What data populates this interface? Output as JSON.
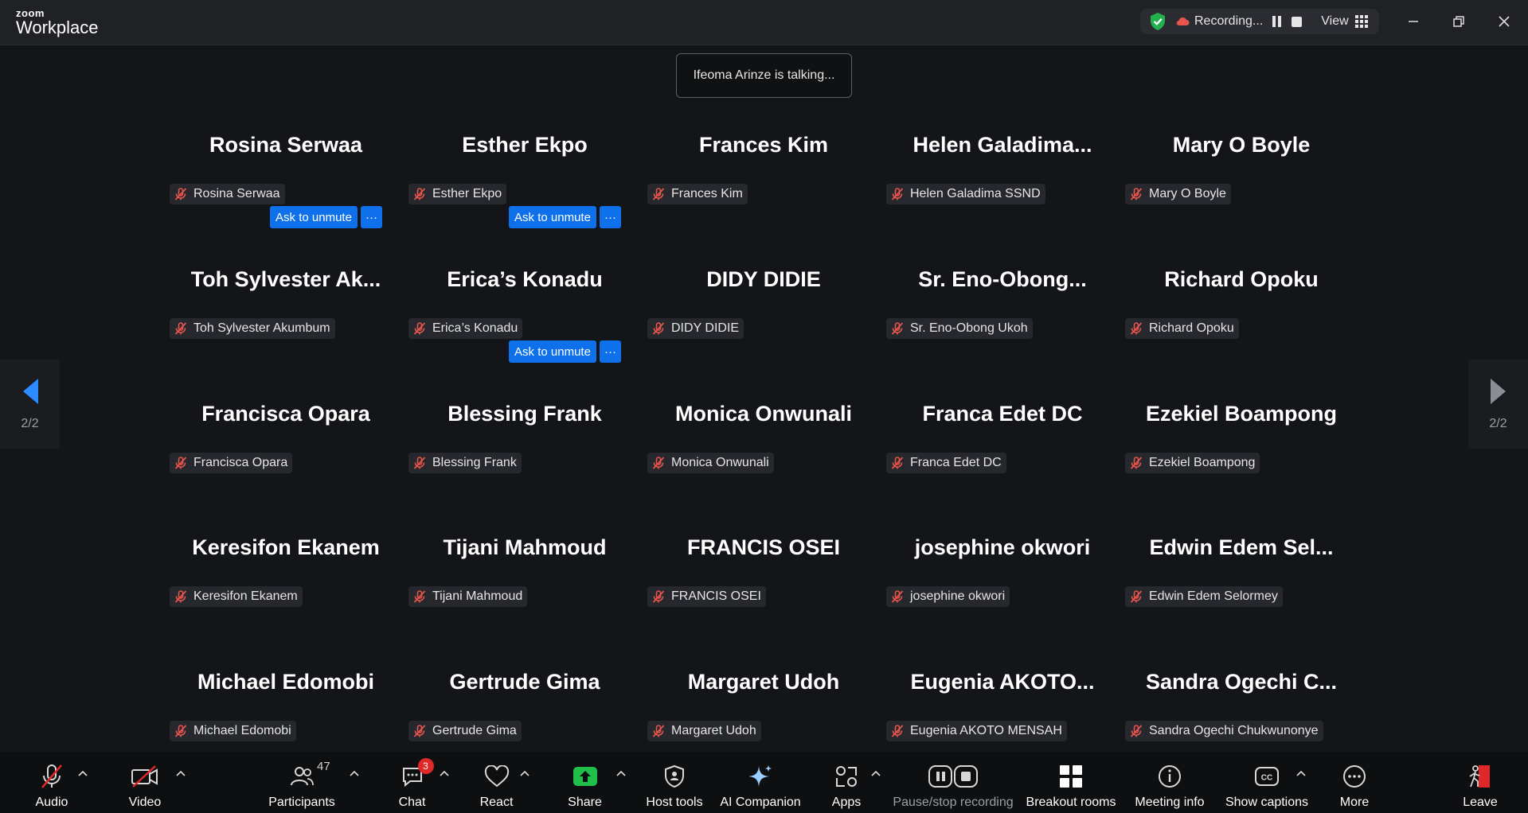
{
  "titlebar": {
    "brand_small": "zoom",
    "brand_big": "Workplace",
    "recording_label": "Recording...",
    "view_label": "View"
  },
  "toast": "Ifeoma Arinze is talking...",
  "ask_label": "Ask to unmute",
  "more_label": "···",
  "pager": {
    "left": "2/2",
    "right": "2/2"
  },
  "participants": [
    {
      "display": "Rosina Serwaa",
      "label": "Rosina Serwaa",
      "ask": true
    },
    {
      "display": "Esther Ekpo",
      "label": "Esther Ekpo",
      "ask": true
    },
    {
      "display": "Frances Kim",
      "label": "Frances Kim",
      "ask": false
    },
    {
      "display": "Helen  Galadima...",
      "label": "Helen Galadima SSND",
      "ask": false
    },
    {
      "display": "Mary O Boyle",
      "label": "Mary O Boyle",
      "ask": false
    },
    {
      "display": "Toh Sylvester Ak...",
      "label": "Toh Sylvester Akumbum",
      "ask": false
    },
    {
      "display": "Erica’s Konadu",
      "label": "Erica’s Konadu",
      "ask": true
    },
    {
      "display": "DIDY DIDIE",
      "label": "DIDY DIDIE",
      "ask": false
    },
    {
      "display": "Sr.  Eno-Obong...",
      "label": "Sr. Eno-Obong Ukoh",
      "ask": false
    },
    {
      "display": "Richard Opoku",
      "label": "Richard Opoku",
      "ask": false
    },
    {
      "display": "Francisca Opara",
      "label": "Francisca Opara",
      "ask": false
    },
    {
      "display": "Blessing Frank",
      "label": "Blessing Frank",
      "ask": false
    },
    {
      "display": "Monica Onwunali",
      "label": "Monica Onwunali",
      "ask": false
    },
    {
      "display": "Franca Edet DC",
      "label": "Franca Edet DC",
      "ask": false
    },
    {
      "display": "Ezekiel Boampong",
      "label": "Ezekiel Boampong",
      "ask": false
    },
    {
      "display": "Keresifon Ekanem",
      "label": "Keresifon Ekanem",
      "ask": false
    },
    {
      "display": "Tijani Mahmoud",
      "label": "Tijani Mahmoud",
      "ask": false
    },
    {
      "display": "FRANCIS OSEI",
      "label": "FRANCIS OSEI",
      "ask": false
    },
    {
      "display": "josephine okwori",
      "label": "josephine okwori",
      "ask": false
    },
    {
      "display": "Edwin Edem Sel...",
      "label": "Edwin Edem Selormey",
      "ask": false
    },
    {
      "display": "Michael Edomobi",
      "label": "Michael Edomobi",
      "ask": false
    },
    {
      "display": "Gertrude Gima",
      "label": "Gertrude Gima",
      "ask": false
    },
    {
      "display": "Margaret Udoh",
      "label": "Margaret Udoh",
      "ask": false
    },
    {
      "display": "Eugenia  AKOTO...",
      "label": "Eugenia AKOTO MENSAH",
      "ask": false
    },
    {
      "display": "Sandra Ogechi C...",
      "label": "Sandra Ogechi Chukwunonye",
      "ask": false
    }
  ],
  "toolbar": {
    "audio": "Audio",
    "video": "Video",
    "participants": "Participants",
    "participants_count": "47",
    "chat": "Chat",
    "chat_badge": "3",
    "react": "React",
    "share": "Share",
    "host_tools": "Host tools",
    "ai_companion": "AI Companion",
    "apps": "Apps",
    "pause_recording": "Pause/stop recording",
    "breakout": "Breakout rooms",
    "meeting_info": "Meeting info",
    "captions": "Show captions",
    "more": "More",
    "leave": "Leave"
  },
  "colors": {
    "accent": "#0e71eb",
    "background": "#131519",
    "muted_red": "#e02828",
    "share_green": "#1fbf4a"
  }
}
